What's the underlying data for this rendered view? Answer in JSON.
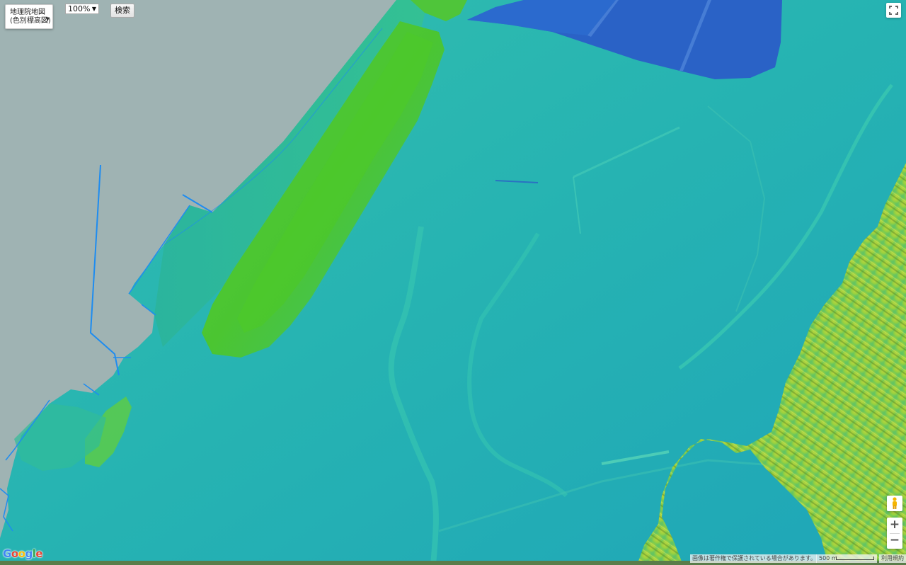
{
  "map": {
    "map_type_selector": {
      "line1": "地理院地図",
      "line2": "(色別標高図)"
    },
    "opacity_selector": {
      "value": "100%"
    },
    "search_button_label": "検索",
    "attribution_text": "画像は著作権で保護されている場合があります。",
    "scale_label": "500 m",
    "terms_link_label": "利用規約",
    "logo_text": [
      "G",
      "o",
      "o",
      "g",
      "l",
      "e"
    ],
    "zoom_in_label": "+",
    "zoom_out_label": "−"
  },
  "colors": {
    "sea": "#9fb3b3",
    "lowland": "#29b9b0",
    "low_elevation": "#1fa8b6",
    "ridge": "#5fcf4a",
    "ridge_peak": "#49c22e",
    "reclaimed_land": "#2a62c6",
    "hills": "#a8d63c",
    "waterline": "#1e8cf0"
  },
  "icons": [
    "fullscreen-icon",
    "pegman-icon",
    "zoom-in-icon",
    "zoom-out-icon",
    "dropdown-caret-icon"
  ]
}
